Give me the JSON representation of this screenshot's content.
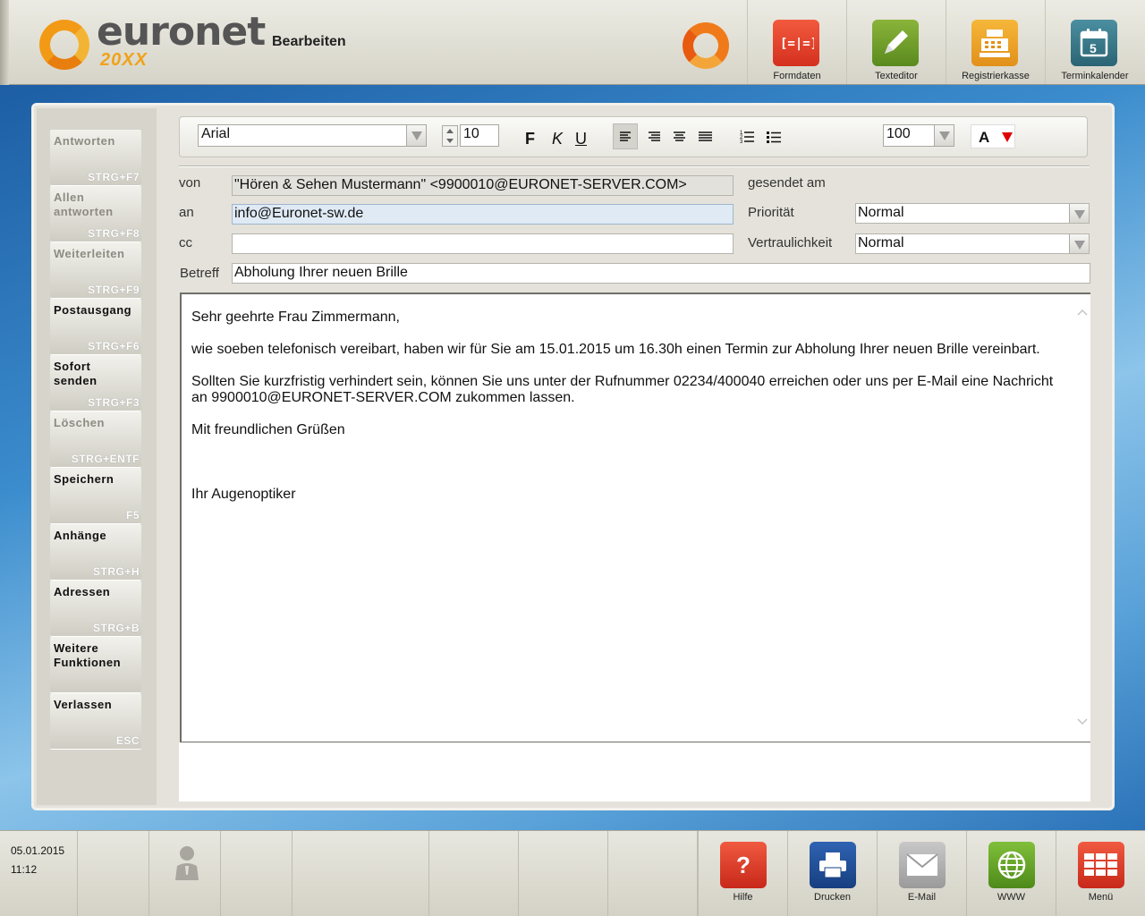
{
  "header": {
    "logo_text": "euronet",
    "logo_sub": "20XX",
    "mode_title": "Bearbeiten"
  },
  "top_tools": [
    {
      "label": "Formdaten",
      "icon": "formdaten-icon",
      "color": "#e8402a"
    },
    {
      "label": "Texteditor",
      "icon": "pencil-icon",
      "color": "#6e9a2a"
    },
    {
      "label": "Registrierkasse",
      "icon": "cash-register-icon",
      "color": "#f0a020"
    },
    {
      "label": "Terminkalender",
      "icon": "calendar-icon",
      "color": "#3a7a8a",
      "day": "5"
    }
  ],
  "sidebar": {
    "items": [
      {
        "label": "Antworten",
        "shortcut": "STRG+F7",
        "enabled": false
      },
      {
        "label": "Allen antworten",
        "shortcut": "STRG+F8",
        "enabled": false
      },
      {
        "label": "Weiterleiten",
        "shortcut": "STRG+F9",
        "enabled": false
      },
      {
        "label": "Postausgang",
        "shortcut": "STRG+F6",
        "enabled": true
      },
      {
        "label": "Sofort senden",
        "shortcut": "STRG+F3",
        "enabled": true
      },
      {
        "label": "Löschen",
        "shortcut": "STRG+ENTF",
        "enabled": false
      },
      {
        "label": "Speichern",
        "shortcut": "F5",
        "enabled": true
      },
      {
        "label": "Anhänge",
        "shortcut": "STRG+H",
        "enabled": true
      },
      {
        "label": "Adressen",
        "shortcut": "STRG+B",
        "enabled": true
      },
      {
        "label": "Weitere Funktionen",
        "shortcut": "",
        "enabled": true
      },
      {
        "label": "Verlassen",
        "shortcut": "ESC",
        "enabled": true
      }
    ]
  },
  "toolbar": {
    "font": "Arial",
    "size": "10",
    "bold": "F",
    "italic": "K",
    "underline": "U",
    "zoom": "100",
    "color_label": "A"
  },
  "mail": {
    "von_label": "von",
    "von": "\"Hören & Sehen Mustermann\" <9900010@EURONET-SERVER.COM>",
    "an_label": "an",
    "an": "info@Euronet-sw.de",
    "cc_label": "cc",
    "cc": "",
    "betreff_label": "Betreff",
    "betreff": "Abholung Ihrer neuen Brille",
    "gesendet_label": "gesendet am",
    "prioritaet_label": "Priorität",
    "prioritaet": "Normal",
    "vertraulichkeit_label": "Vertraulichkeit",
    "vertraulichkeit": "Normal"
  },
  "body": {
    "p1": "Sehr geehrte Frau Zimmermann,",
    "p2": "wie soeben telefonisch vereibart, haben wir für Sie am 15.01.2015 um 16.30h einen Termin zur Abholung Ihrer neuen Brille vereinbart.",
    "p3": "Sollten Sie kurzfristig verhindert sein, können Sie uns unter der Rufnummer 02234/400040 erreichen oder uns per E-Mail eine Nachricht an 9900010@EURONET-SERVER.COM zukommen lassen.",
    "p4": "Mit freundlichen Grüßen",
    "p5": "Ihr Augenoptiker"
  },
  "status": {
    "date": "05.01.2015",
    "time": "11:12"
  },
  "bottom_tools": [
    {
      "label": "Hilfe",
      "icon": "help-icon",
      "color": "#e23a28"
    },
    {
      "label": "Drucken",
      "icon": "printer-icon",
      "color": "#1e4f9a"
    },
    {
      "label": "E-Mail",
      "icon": "mail-icon",
      "color": "#a8a8a8"
    },
    {
      "label": "WWW",
      "icon": "globe-icon",
      "color": "#6aa82a"
    },
    {
      "label": "Menü",
      "icon": "menu-grid-icon",
      "color": "#e8402a"
    }
  ]
}
